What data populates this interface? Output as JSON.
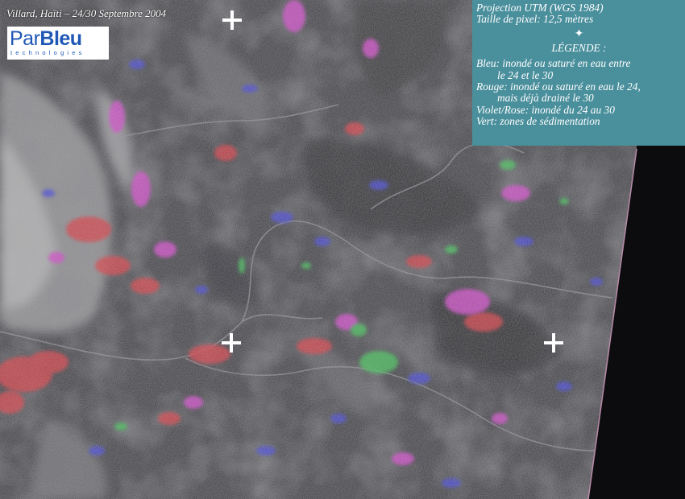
{
  "map_title": "Villard, Haïti – 24/30 Septembre 2004",
  "logo": {
    "name_part1": "Par",
    "name_part2": "Bleu",
    "subtitle": "technologies"
  },
  "legend": {
    "projection": "Projection UTM (WGS 1984)",
    "pixel_size": "Taille de pixel: 12,5 mètres",
    "north_symbol": "✦",
    "heading": "LÉGENDE :",
    "items": [
      {
        "line1": "Bleu: inondé ou saturé en eau entre",
        "line2": "le 24 et le 30"
      },
      {
        "line1": "Rouge: inondé ou saturé en eau le 24,",
        "line2": "mais déjà drainé le 30"
      },
      {
        "line1": "Violet/Rose: inondé du 24 au 30",
        "line2": ""
      },
      {
        "line1": "Vert: zones de sédimentation",
        "line2": ""
      }
    ]
  },
  "colors": {
    "legend_background": "#4a8f9c",
    "blue_flooded": "#3a3ad8",
    "red_drained": "#d8303a",
    "violet_persistent": "#d040c8",
    "green_sediment": "#38c050",
    "logo_blue": "#1f57b5"
  },
  "markers": [
    "cross-top",
    "cross-center",
    "cross-right"
  ]
}
